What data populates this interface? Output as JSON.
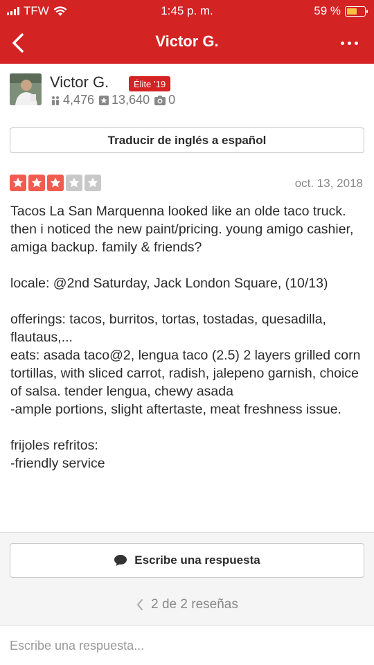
{
  "status_bar": {
    "carrier": "TFW",
    "time": "1:45 p. m.",
    "battery": "59 %",
    "battery_level": 0.59
  },
  "nav": {
    "title": "Victor G."
  },
  "profile": {
    "name": "Victor G.",
    "elite_badge": "Élite ’19",
    "friends": "4,476",
    "reviews": "13,640",
    "photos": "0"
  },
  "translate_button": "Traducir de inglés a español",
  "review": {
    "rating": 3,
    "max_rating": 5,
    "date": "oct. 13, 2018",
    "text": "Tacos La San Marquenna looked like an olde taco truck. then i noticed the new paint/pricing. young amigo cashier, amiga backup. family & friends?\n\nlocale: @2nd Saturday, Jack London Square, (10/13)\n\nofferings: tacos, burritos, tortas, tostadas, quesadilla, flautaus,...\neats: asada taco@2, lengua taco (2.5) 2 layers grilled corn tortillas, with sliced carrot, radish, jalepeno garnish, choice of salsa. tender lengua, chewy asada\n-ample portions, slight aftertaste, meat freshness issue.\n\nfrijoles refritos:\n-friendly service"
  },
  "reply_button": "Escribe una respuesta",
  "pager": "2 de 2 reseñas",
  "reply_input": {
    "placeholder": "Escribe una respuesta..."
  }
}
